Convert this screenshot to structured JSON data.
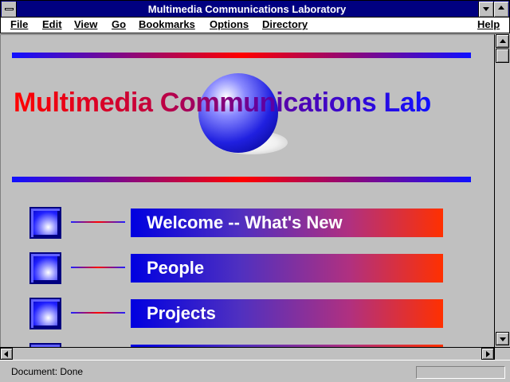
{
  "window": {
    "title": "Multimedia Communications Laboratory"
  },
  "menu": {
    "items": [
      "File",
      "Edit",
      "View",
      "Go",
      "Bookmarks",
      "Options",
      "Directory"
    ],
    "help": "Help"
  },
  "page": {
    "headline": "Multimedia Communications Lab",
    "nav": [
      {
        "label": "Welcome -- What's New"
      },
      {
        "label": "People"
      },
      {
        "label": "Projects"
      },
      {
        "label": ""
      }
    ]
  },
  "status": {
    "text": "Document: Done"
  },
  "colors": {
    "titlebar": "#000080",
    "accent_red": "#ff0000",
    "accent_blue": "#1010ff",
    "chrome": "#c0c0c0"
  },
  "icons": {
    "system_menu": "system-menu-icon",
    "minimize": "minimize-icon",
    "maximize": "maximize-icon",
    "nav_bullet": "blue-square-bullet-icon",
    "scroll_up": "arrow-up-icon",
    "scroll_down": "arrow-down-icon",
    "scroll_left": "arrow-left-icon",
    "scroll_right": "arrow-right-icon"
  }
}
